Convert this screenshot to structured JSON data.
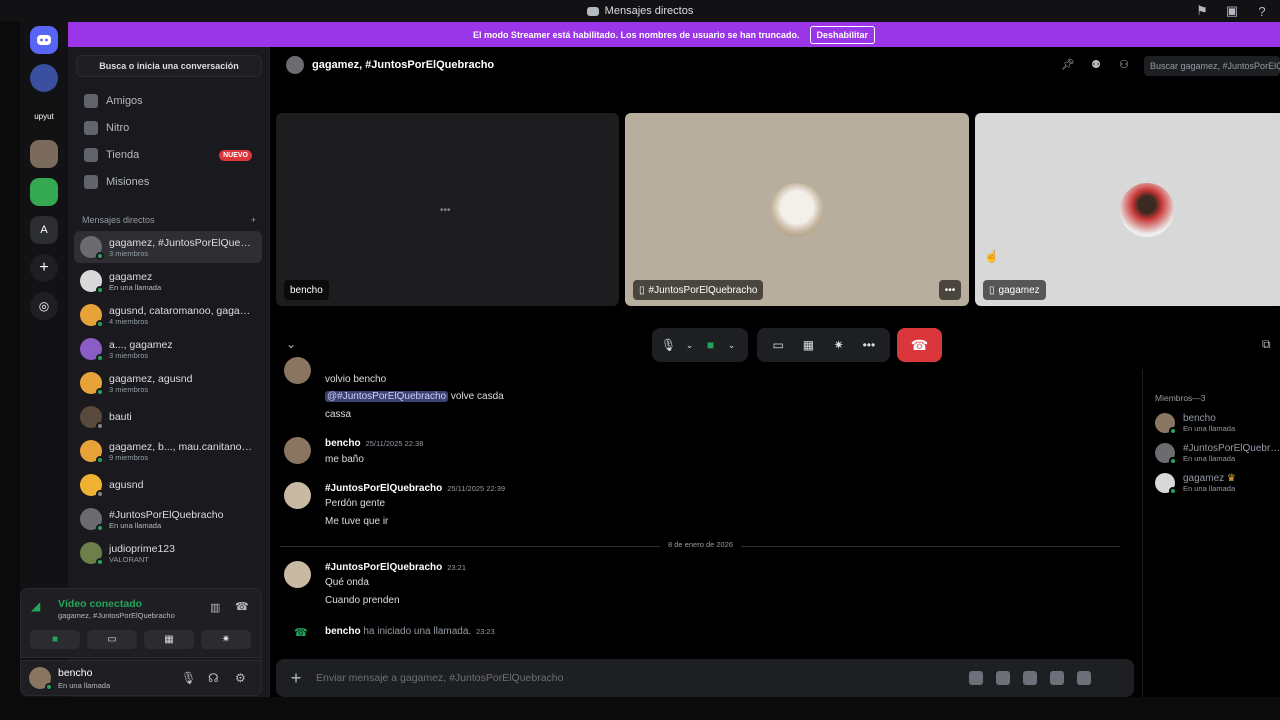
{
  "window": {
    "title": "Mensajes directos"
  },
  "banner": {
    "text": "El modo Streamer está habilitado. Los nombres de usuario se han truncado.",
    "button": "Deshabilitar"
  },
  "servers": [
    {
      "label": ""
    },
    {
      "label": ""
    },
    {
      "label": "upyut"
    },
    {
      "label": ""
    },
    {
      "label": ""
    },
    {
      "label": "A"
    },
    {
      "label": "+"
    },
    {
      "label": ""
    }
  ],
  "sidebar": {
    "search_label": "Busca o inicia una conversación",
    "nav": [
      {
        "label": "Amigos"
      },
      {
        "label": "Nitro"
      },
      {
        "label": "Tienda",
        "badge": "NUEVO"
      },
      {
        "label": "Misiones"
      }
    ],
    "dm_header": "Mensajes directos",
    "dm_add": "+",
    "dms": [
      {
        "name": "gagamez, #JuntosPorElQuebracho",
        "sub": "3 miembros"
      },
      {
        "name": "gagamez",
        "sub": "En una llamada"
      },
      {
        "name": "agusnd, cataromanoo, gagamez",
        "sub": "4 miembros"
      },
      {
        "name": "a..., gagamez",
        "sub": "3 miembros"
      },
      {
        "name": "gagamez, agusnd",
        "sub": "3 miembros"
      },
      {
        "name": "bauti",
        "sub": ""
      },
      {
        "name": "gagamez, b..., mau.canitano, ...",
        "sub": "9 miembros"
      },
      {
        "name": "agusnd",
        "sub": ""
      },
      {
        "name": "#JuntosPorElQuebracho",
        "sub": "En una llamada"
      },
      {
        "name": "judioprime123",
        "sub": "VALORANT"
      }
    ]
  },
  "voice": {
    "title": "Vídeo conectado",
    "sub": "gagamez, #JuntosPorElQuebracho"
  },
  "user": {
    "name": "bencho",
    "status": "En una llamada"
  },
  "channel": {
    "title": "gagamez, #JuntosPorElQuebracho",
    "search_placeholder": "Buscar gagamez, #JuntosPorElQuebracho"
  },
  "tiles": [
    {
      "label": "bencho"
    },
    {
      "label": "#JuntosPorElQuebracho"
    },
    {
      "label": "gagamez"
    }
  ],
  "messages": {
    "m0": {
      "line1": "volvio bencho",
      "mention": "@#JuntosPorElQuebracho",
      "line2_rest": " volve casda",
      "line3": "cassa"
    },
    "m1": {
      "author": "bencho",
      "time": "25/11/2025 22:38",
      "line1": "me baño"
    },
    "m2": {
      "author": "#JuntosPorElQuebracho",
      "time": "25/11/2025 22:39",
      "line1": "Perdón gente",
      "line2": "Me tuve que ir"
    },
    "divider": "8 de enero de 2026",
    "m3": {
      "author": "#JuntosPorElQuebracho",
      "time": "23:21",
      "line1": "Qué onda",
      "line2": "Cuando prenden"
    },
    "call": {
      "author": "bencho",
      "text": "ha iniciado una llamada.",
      "time": "23:23"
    }
  },
  "composer": {
    "placeholder": "Enviar mensaje a gagamez, #JuntosPorElQuebracho"
  },
  "members": {
    "header": "Miembros—3",
    "list": [
      {
        "name": "bencho",
        "sub": "En una llamada"
      },
      {
        "name": "#JuntosPorElQuebracho",
        "sub": "En una llamada"
      },
      {
        "name": "gagamez",
        "sub": "En una llamada"
      }
    ]
  },
  "colors": {
    "accent": "#9b36e8",
    "online": "#23a55a",
    "danger": "#da373c",
    "brand": "#5865f2"
  }
}
